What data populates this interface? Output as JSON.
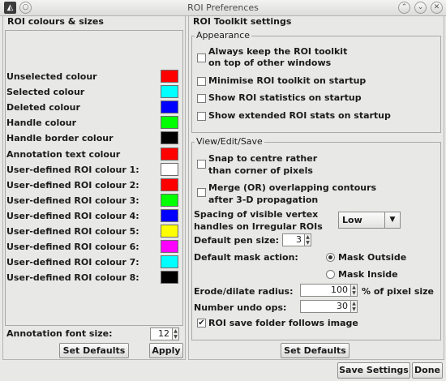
{
  "window": {
    "title": "ROI Preferences"
  },
  "left": {
    "title": "ROI colours & sizes",
    "items": [
      {
        "label": "Unselected colour",
        "color": "#ff0000"
      },
      {
        "label": "Selected colour",
        "color": "#00ffff"
      },
      {
        "label": "Deleted colour",
        "color": "#0000ff"
      },
      {
        "label": "Handle colour",
        "color": "#00ff00"
      },
      {
        "label": "Handle border colour",
        "color": "#000000"
      },
      {
        "label": "Annotation text colour",
        "color": "#ff0000"
      },
      {
        "label": "User-defined ROI colour 1:",
        "color": "#ffffff"
      },
      {
        "label": "User-defined ROI colour 2:",
        "color": "#ff0000"
      },
      {
        "label": "User-defined ROI colour 3:",
        "color": "#00ff00"
      },
      {
        "label": "User-defined ROI colour 4:",
        "color": "#0000ff"
      },
      {
        "label": "User-defined ROI colour 5:",
        "color": "#ffff00"
      },
      {
        "label": "User-defined ROI colour 6:",
        "color": "#ff00ff"
      },
      {
        "label": "User-defined ROI colour 7:",
        "color": "#00ffff"
      },
      {
        "label": "User-defined ROI colour 8:",
        "color": "#000000"
      }
    ],
    "font_size_label": "Annotation font size:",
    "font_size_value": "12",
    "set_defaults": "Set Defaults",
    "apply": "Apply"
  },
  "right": {
    "title": "ROI Toolkit settings",
    "appearance": {
      "title": "Appearance",
      "always_on_top": [
        "Always keep the ROI toolkit",
        "on top of other windows"
      ],
      "minimise": "Minimise ROI toolkit on startup",
      "show_stats": "Show ROI statistics on startup",
      "show_extended": "Show extended ROI stats on startup"
    },
    "ves": {
      "title": "View/Edit/Save",
      "snap": [
        "Snap to centre rather",
        "than corner of pixels"
      ],
      "merge": [
        "Merge (OR) overlapping contours",
        "after 3-D propagation"
      ],
      "spacing": [
        "Spacing of visible vertex",
        "handles on Irregular ROIs"
      ],
      "spacing_value": "Low",
      "pen_label": "Default pen size:",
      "pen_value": "3",
      "mask_label": "Default mask action:",
      "mask_outside": "Mask Outside",
      "mask_inside": "Mask Inside",
      "erode_label": "Erode/dilate radius:",
      "erode_value": "100",
      "erode_unit": "% of pixel size",
      "undo_label": "Number undo ops:",
      "undo_value": "30",
      "save_folder": "ROI save folder follows image",
      "save_folder_checked": "✔"
    },
    "set_defaults": "Set Defaults"
  },
  "bottom": {
    "save_settings": "Save Settings",
    "done": "Done"
  }
}
